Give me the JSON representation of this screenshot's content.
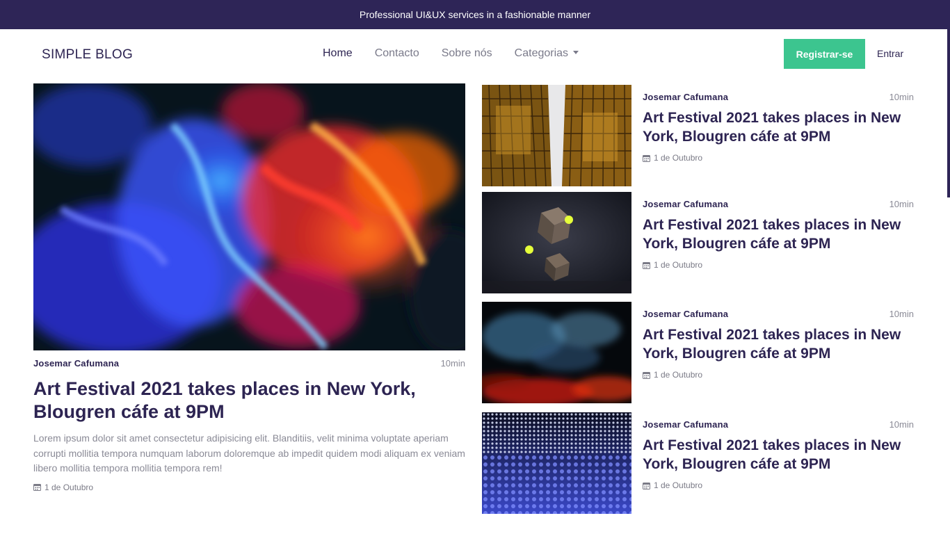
{
  "topbar": {
    "text": "Professional UI&UX services in a fashionable manner"
  },
  "nav": {
    "brand": "SIMPLE BLOG",
    "links": [
      "Home",
      "Contacto",
      "Sobre nós",
      "Categorias"
    ],
    "register": "Registrar-se",
    "login": "Entrar"
  },
  "featured": {
    "author": "Josemar Cafumana",
    "read_time": "10min",
    "title": "Art Festival 2021 takes places in New York, Blougren cáfe at 9PM",
    "excerpt": "Lorem ipsum dolor sit amet consectetur adipisicing elit. Blanditiis, velit minima voluptate aperiam corrupti mollitia tempora numquam laborum doloremque ab impedit quidem modi aliquam ex veniam libero mollitia tempora mollitia tempora rem!",
    "date": "1 de Outubro",
    "image": "abstract-ink-smoke-image"
  },
  "posts": [
    {
      "author": "Josemar Cafumana",
      "read_time": "10min",
      "title": "Art Festival 2021 takes places in New York, Blougren cáfe at 9PM",
      "date": "1 de Outubro",
      "image": "skyscrapers-image"
    },
    {
      "author": "Josemar Cafumana",
      "read_time": "10min",
      "title": "Art Festival 2021 takes places in New York, Blougren cáfe at 9PM",
      "date": "1 de Outubro",
      "image": "cubes-spheres-image"
    },
    {
      "author": "Josemar Cafumana",
      "read_time": "10min",
      "title": "Art Festival 2021 takes places in New York, Blougren cáfe at 9PM",
      "date": "1 de Outubro",
      "image": "smoke-ember-image"
    },
    {
      "author": "Josemar Cafumana",
      "read_time": "10min",
      "title": "Art Festival 2021 takes places in New York, Blougren cáfe at 9PM",
      "date": "1 de Outubro",
      "image": "led-grid-image"
    }
  ],
  "colors": {
    "primary": "#2e2557",
    "accent": "#3cc58f",
    "muted": "#8a8a96"
  }
}
